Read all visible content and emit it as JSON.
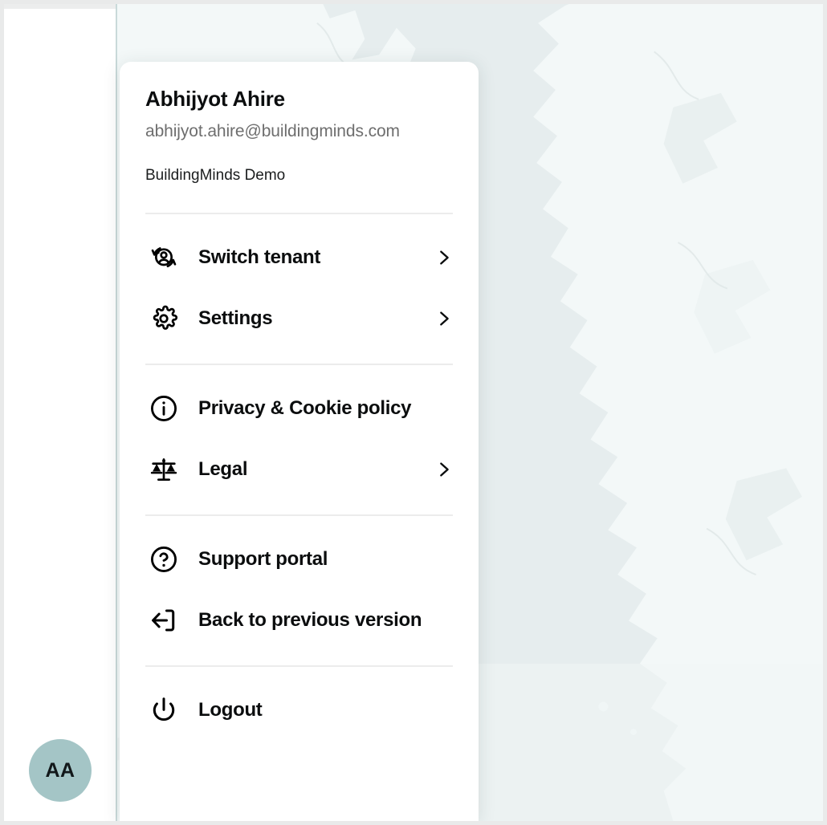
{
  "window": {
    "background_map_water": "#e6edee",
    "background_map_land": "#f3f8f8",
    "frame_border": "#e9eaea"
  },
  "sidebar": {
    "avatar": {
      "initials": "AA",
      "background_color": "#a4c5c6",
      "text_color": "#12181a"
    }
  },
  "account_panel": {
    "user_name": "Abhijyot Ahire",
    "user_email": "abhijyot.ahire@buildingminds.com",
    "tenant_name": "BuildingMinds Demo",
    "groups": [
      {
        "items": [
          {
            "label": "Switch tenant",
            "icon": "switch-user-icon",
            "has_chevron": true
          },
          {
            "label": "Settings",
            "icon": "gear-icon",
            "has_chevron": true
          }
        ]
      },
      {
        "items": [
          {
            "label": "Privacy & Cookie policy",
            "icon": "info-circle-icon",
            "has_chevron": false
          },
          {
            "label": "Legal",
            "icon": "scales-of-justice-icon",
            "has_chevron": true
          }
        ]
      },
      {
        "items": [
          {
            "label": "Support portal",
            "icon": "question-circle-icon",
            "has_chevron": false
          },
          {
            "label": "Back to previous version",
            "icon": "arrow-left-exit-icon",
            "has_chevron": false
          }
        ]
      },
      {
        "items": [
          {
            "label": "Logout",
            "icon": "power-icon",
            "has_chevron": false
          }
        ]
      }
    ]
  }
}
